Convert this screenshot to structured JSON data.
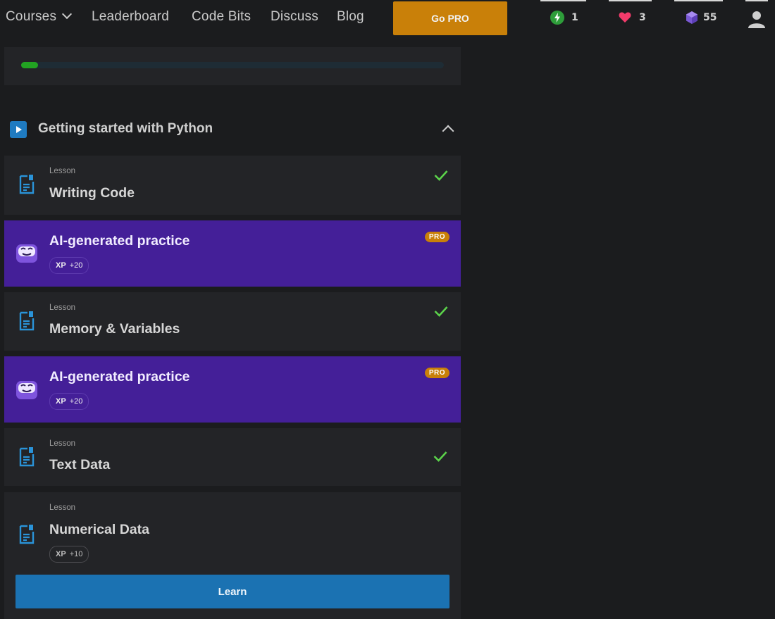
{
  "nav": {
    "courses_label": "Courses",
    "leaderboard_label": "Leaderboard",
    "code_bits_label": "Code Bits",
    "discuss_label": "Discuss",
    "blog_label": "Blog",
    "go_pro_label": "Go PRO",
    "streak_count": "1",
    "hearts_count": "3",
    "bits_count": "55"
  },
  "course_progress_fraction": 0.04,
  "section": {
    "title": "Getting started with Python",
    "items": [
      {
        "kind": "lesson",
        "kicker": "Lesson",
        "title": "Writing Code",
        "completed": true
      },
      {
        "kind": "ai",
        "title": "AI-generated practice",
        "badge": "PRO",
        "xp_label": "XP",
        "xp_value": "+20"
      },
      {
        "kind": "lesson",
        "kicker": "Lesson",
        "title": "Memory & Variables",
        "completed": true
      },
      {
        "kind": "ai",
        "title": "AI-generated practice",
        "badge": "PRO",
        "xp_label": "XP",
        "xp_value": "+20"
      },
      {
        "kind": "lesson",
        "kicker": "Lesson",
        "title": "Text Data",
        "completed": true
      },
      {
        "kind": "lesson",
        "kicker": "Lesson",
        "title": "Numerical Data",
        "completed": false,
        "xp_label": "XP",
        "xp_value": "+10",
        "button_label": "Learn"
      }
    ]
  },
  "colors": {
    "accent_orange": "#c98009",
    "ai_purple": "#441f98",
    "learn_blue": "#1b72b2",
    "check_green": "#5bd24a"
  }
}
